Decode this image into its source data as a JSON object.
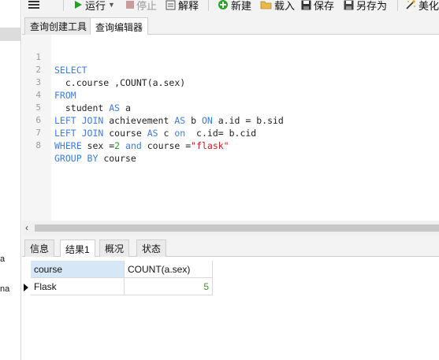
{
  "sidebar_fragments": [
    "a",
    "na"
  ],
  "toolbar": {
    "run": "运行",
    "stop": "停止",
    "explain": "解释",
    "new": "新建",
    "load": "载入",
    "save": "保存",
    "save_as": "另存为",
    "beautify": "美化"
  },
  "top_tabs": [
    {
      "label": "查询创建工具",
      "active": false
    },
    {
      "label": "查询编辑器",
      "active": true
    }
  ],
  "editor": {
    "lines": [
      {
        "n": "1",
        "code": "SELECT"
      },
      {
        "n": "2",
        "code": "  c.course ,COUNT(a.sex)"
      },
      {
        "n": "3",
        "code": "FROM"
      },
      {
        "n": "4",
        "code": "  student AS a"
      },
      {
        "n": "5",
        "code": "LEFT JOIN achievement AS b ON a.id = b.sid"
      },
      {
        "n": "6",
        "code": "LEFT JOIN course AS c on  c.id= b.cid"
      },
      {
        "n": "7",
        "code": "WHERE sex =2 and course =\"flask\""
      },
      {
        "n": "8",
        "code": "GROUP BY course"
      }
    ]
  },
  "bottom_tabs": [
    {
      "label": "信息",
      "active": false
    },
    {
      "label": "结果1",
      "active": true
    },
    {
      "label": "概况",
      "active": false
    },
    {
      "label": "状态",
      "active": false
    }
  ],
  "result": {
    "columns": [
      "course",
      "COUNT(a.sex)"
    ],
    "rows": [
      [
        "Flask",
        "5"
      ]
    ]
  },
  "colors": {
    "keyword": "#3b7ddd",
    "number": "#2a9d2a",
    "string": "#c02020",
    "selected_header": "#d6e8f8",
    "run_icon": "#22a122"
  }
}
